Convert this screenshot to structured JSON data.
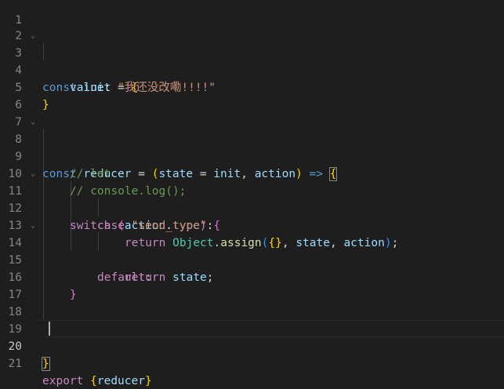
{
  "theme": {
    "background": "#1e1e1e",
    "line_number": "#858585",
    "line_number_active": "#c6c6c6",
    "keyword": "#569cd6",
    "control": "#c586c0",
    "variable": "#9cdcfe",
    "string": "#ce9178",
    "comment": "#6a9955",
    "function": "#dcdcaa",
    "class": "#4ec9b0",
    "bracket_gold": "#ffd700",
    "bracket_purple": "#da70d6",
    "bracket_blue": "#179fff",
    "text": "#d4d4d4"
  },
  "active_line": 20,
  "folds": {
    "line3": "chevron-down",
    "line8": "chevron-down",
    "line11": "chevron-down",
    "line14": "chevron-down"
  },
  "lines": {
    "l1": {
      "number": "1"
    },
    "l2": {
      "number": "2"
    },
    "l3": {
      "number": "3",
      "kw_const": "const",
      "name": "init",
      "eq": " = ",
      "brace": "{"
    },
    "l4": {
      "number": "4",
      "prop": "value",
      "colon": ": ",
      "str": "\"我还没改嘞!!!!\""
    },
    "l5": {
      "number": "5",
      "brace": "}"
    },
    "l6": {
      "number": "6"
    },
    "l7": {
      "number": "7"
    },
    "l8": {
      "number": "8",
      "kw_const": "const",
      "name": "reducer",
      "eq": " = ",
      "paren_open": "(",
      "p1": "state",
      "eq2": " = ",
      "p1_default": "init",
      "comma": ", ",
      "p2": "action",
      "paren_close": ")",
      "arrow": " => ",
      "brace": "{"
    },
    "l9": {
      "number": "9",
      "comment": "// let"
    },
    "l10": {
      "number": "10",
      "comment": "// console.log();"
    },
    "l11": {
      "number": "11",
      "kw_switch": "switch",
      "space": " ",
      "paren_open": "(",
      "obj": "action",
      "dot": ".",
      "prop": "type",
      "paren_close": ")",
      "space2": " ",
      "brace": "{"
    },
    "l12": {
      "number": "12",
      "kw_case": "case",
      "space": " ",
      "str": "\"send_type\"",
      "colon": ":"
    },
    "l13": {
      "number": "13",
      "kw_return": "return",
      "space": " ",
      "cls": "Object",
      "dot": ".",
      "fn": "assign",
      "paren_open": "(",
      "obj_open": "{",
      "obj_close": "}",
      "comma1": ", ",
      "a1": "state",
      "comma2": ", ",
      "a2": "action",
      "paren_close": ")",
      "semi": ";"
    },
    "l14": {
      "number": "14",
      "kw_default": "default",
      "colon": ":"
    },
    "l15": {
      "number": "15",
      "kw_return": "return",
      "space": " ",
      "val": "state",
      "semi": ";"
    },
    "l16": {
      "number": "16",
      "brace": "}"
    },
    "l17": {
      "number": "17"
    },
    "l18": {
      "number": "18"
    },
    "l19": {
      "number": "19"
    },
    "l20": {
      "number": "20",
      "brace": "}"
    },
    "l21": {
      "number": "21",
      "kw_export": "export",
      "space": " ",
      "brace_open": "{",
      "name": "reducer",
      "brace_close": "}"
    }
  }
}
